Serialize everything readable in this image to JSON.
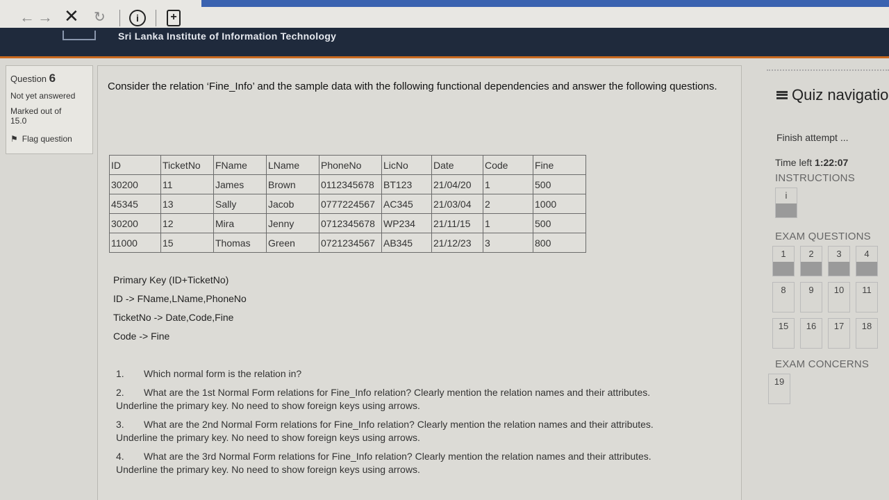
{
  "browser": {
    "back_icon": "arrow-left-icon",
    "forward_icon": "arrow-right-icon",
    "close_icon": "close-icon",
    "reload_icon": "reload-icon",
    "info_icon": "info-icon",
    "info_glyph": "i",
    "newtab_glyph": "+"
  },
  "site": {
    "title": "Sri Lanka Institute of Information Technology"
  },
  "question_info": {
    "label": "Question",
    "number": "6",
    "status": "Not yet answered",
    "marked": "Marked out of",
    "mark_value": "15.0",
    "flag_label": "Flag question"
  },
  "question": {
    "intro": "Consider the relation ‘Fine_Info’ and the sample data with the following functional dependencies and answer the following questions.",
    "table": {
      "headers": [
        "ID",
        "TicketNo",
        "FName",
        "LName",
        "PhoneNo",
        "LicNo",
        "Date",
        "Code",
        "Fine"
      ],
      "rows": [
        [
          "30200",
          "11",
          "James",
          "Brown",
          "0112345678",
          "BT123",
          "21/04/20",
          "1",
          "500"
        ],
        [
          "45345",
          "13",
          "Sally",
          "Jacob",
          "0777224567",
          "AC345",
          "21/03/04",
          "2",
          "1000"
        ],
        [
          "30200",
          "12",
          "Mira",
          "Jenny",
          "0712345678",
          "WP234",
          "21/11/15",
          "1",
          "500"
        ],
        [
          "11000",
          "15",
          "Thomas",
          "Green",
          "0721234567",
          "AB345",
          "21/12/23",
          "3",
          "800"
        ]
      ]
    },
    "dependencies": [
      "Primary Key (ID+TicketNo)",
      "ID -> FName,LName,PhoneNo",
      "TicketNo -> Date,Code,Fine",
      "Code -> Fine"
    ],
    "subquestions": [
      {
        "num": "1.",
        "text": "Which normal form is the relation in?"
      },
      {
        "num": "2.",
        "text": "What are the 1st Normal Form relations for Fine_Info relation? Clearly mention the relation names and their attributes. Underline the primary key. No need to show foreign keys using arrows."
      },
      {
        "num": "3.",
        "text": "What are the 2nd Normal Form relations for Fine_Info relation? Clearly mention the relation names and their attributes. Underline the primary key. No need to show foreign keys using arrows."
      },
      {
        "num": "4.",
        "text": "What are the 3rd Normal Form relations for Fine_Info relation? Clearly mention the relation names and their attributes. Underline the primary key. No need to show foreign keys using arrows."
      }
    ]
  },
  "sidebar": {
    "title": "Quiz navigatio",
    "finish": "Finish attempt ...",
    "time_label": "Time left",
    "time_value": "1:22:07",
    "instructions_label": "INSTRUCTIONS",
    "instructions_item": "i",
    "exam_questions_label": "EXAM QUESTIONS",
    "exam_questions": [
      "1",
      "2",
      "3",
      "4",
      "8",
      "9",
      "10",
      "11",
      "15",
      "16",
      "17",
      "18"
    ],
    "exam_concerns_label": "EXAM CONCERNS",
    "exam_concerns": [
      "19"
    ]
  }
}
